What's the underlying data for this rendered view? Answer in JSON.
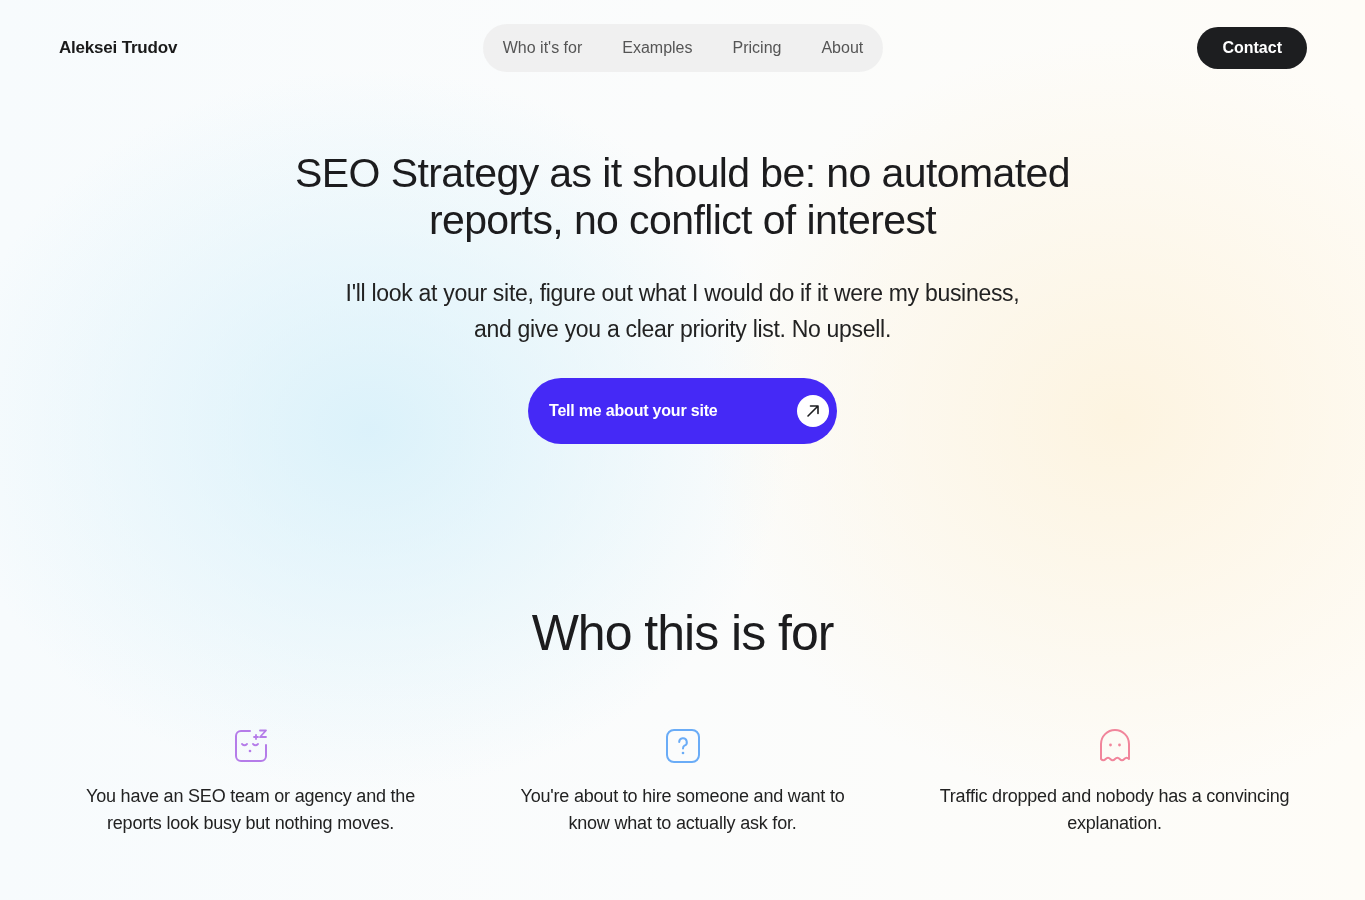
{
  "header": {
    "logo": "Aleksei Trudov",
    "nav": [
      "Who it's for",
      "Examples",
      "Pricing",
      "About"
    ],
    "contact_button": "Contact"
  },
  "hero": {
    "title": "SEO Strategy as it should be: no automated reports, no conflict of interest",
    "subtitle": "I'll look at your site, figure out what I would do if it were my business, and give you a clear priority list. No upsell.",
    "cta": "Tell me about your site"
  },
  "audience": {
    "heading": "Who this is for",
    "items": [
      {
        "text": "You have an SEO team or agency and the reports look busy but nothing moves.",
        "color": "#b57ce9"
      },
      {
        "text": "You're about to hire someone and want to know what to actually ask for.",
        "color": "#6aacf7"
      },
      {
        "text": "Traffic dropped and nobody has a convincing explanation.",
        "color": "#f1859b"
      }
    ]
  }
}
